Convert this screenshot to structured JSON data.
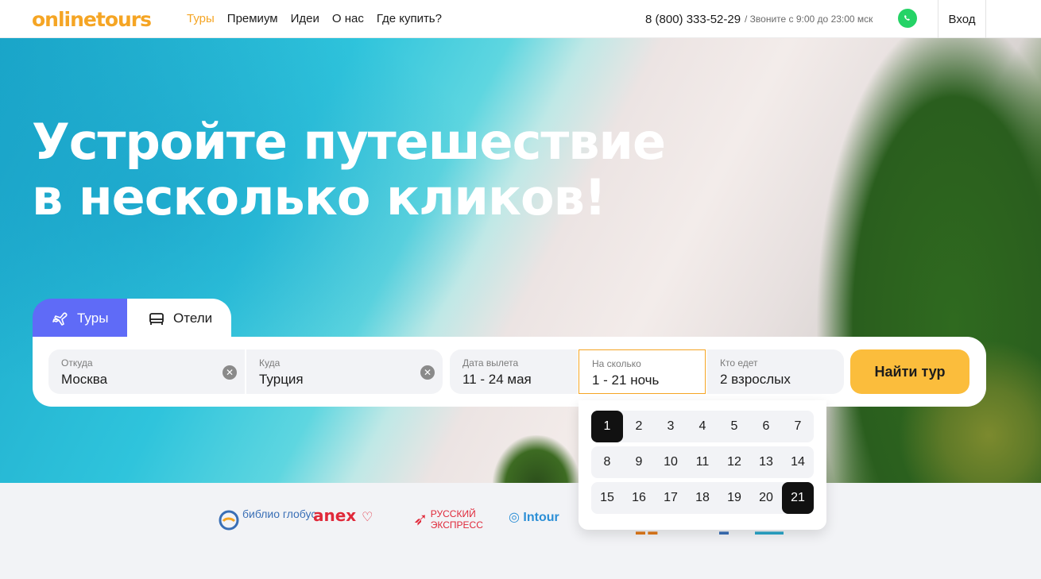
{
  "header": {
    "logo": "onlinetours",
    "nav": [
      "Туры",
      "Премиум",
      "Идеи",
      "О нас",
      "Где купить?"
    ],
    "phone": "8 (800) 333-52-29",
    "phone_note": "/ Звоните с 9:00 до 23:00 мск",
    "login": "Вход"
  },
  "hero": {
    "headline_line1": "Устройте путешествие",
    "headline_line2": "в несколько кликов!"
  },
  "tabs": [
    "Туры",
    "Отели"
  ],
  "search": {
    "from": {
      "label": "Откуда",
      "value": "Москва"
    },
    "to": {
      "label": "Куда",
      "value": "Турция"
    },
    "date": {
      "label": "Дата вылета",
      "value": "11 - 24 мая"
    },
    "nights": {
      "label": "На сколько",
      "value": "1 - 21 ночь"
    },
    "who": {
      "label": "Кто едет",
      "value": "2 взрослых"
    },
    "submit": "Найти тур"
  },
  "nights_picker": {
    "rows": [
      [
        "1",
        "2",
        "3",
        "4",
        "5",
        "6",
        "7"
      ],
      [
        "8",
        "9",
        "10",
        "11",
        "12",
        "13",
        "14"
      ],
      [
        "15",
        "16",
        "17",
        "18",
        "19",
        "20",
        "21"
      ]
    ],
    "selected_start": "1",
    "selected_end": "21"
  },
  "partners": {
    "biblio": "библио глобус",
    "anex": "anex",
    "rusexp": "РУССКИЙ ЭКСПРЕСС",
    "intourist": "Intour"
  },
  "colors": {
    "accent": "#f5a524",
    "tab_active": "#5f6bf7",
    "button": "#fbbd3c",
    "whatsapp": "#25d366"
  }
}
